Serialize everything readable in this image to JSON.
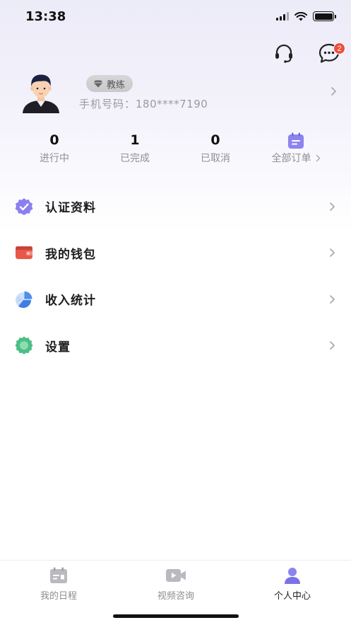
{
  "status_bar": {
    "time": "13:38"
  },
  "header": {
    "message_badge": "2"
  },
  "profile": {
    "role_tag": "教练",
    "phone_label": "手机号码：",
    "phone_value": "180****7190"
  },
  "orders": [
    {
      "count": "0",
      "label": "进行中"
    },
    {
      "count": "1",
      "label": "已完成"
    },
    {
      "count": "0",
      "label": "已取消"
    }
  ],
  "all_orders_label": "全部订单",
  "menu": [
    {
      "label": "认证资料",
      "icon": "verified-badge-icon",
      "color": "#7b6cf0"
    },
    {
      "label": "我的钱包",
      "icon": "wallet-icon",
      "color": "#e8584a"
    },
    {
      "label": "收入统计",
      "icon": "pie-chart-icon",
      "color": "#4f8ff0"
    },
    {
      "label": "设置",
      "icon": "gear-icon",
      "color": "#3fbf80"
    }
  ],
  "tabs": [
    {
      "label": "我的日程",
      "icon": "calendar-icon",
      "active": false
    },
    {
      "label": "视频咨询",
      "icon": "video-icon",
      "active": false
    },
    {
      "label": "个人中心",
      "icon": "person-icon",
      "active": true
    }
  ],
  "colors": {
    "accent": "#7b72e9",
    "badge": "#ef4d3b"
  }
}
